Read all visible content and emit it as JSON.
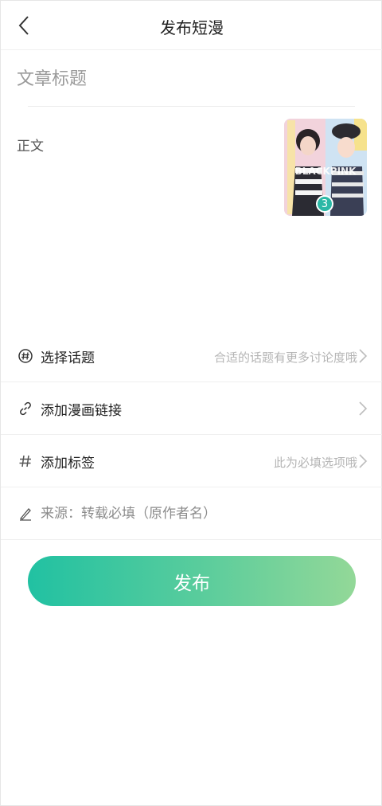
{
  "header": {
    "title": "发布短漫",
    "back_icon": "chevron-left-icon"
  },
  "title_field": {
    "placeholder": "文章标题",
    "value": ""
  },
  "body_field": {
    "placeholder": "正文",
    "value": ""
  },
  "thumbnail": {
    "badge_count": "3",
    "watermark_text": "BLACKPINK"
  },
  "rows": {
    "topic": {
      "label": "选择话题",
      "hint": "合适的话题有更多讨论度哦",
      "icon": "hashtag-bubble-icon"
    },
    "comic_link": {
      "label": "添加漫画链接",
      "icon": "link-icon"
    },
    "tags": {
      "label": "添加标签",
      "hint": "此为必填选项哦",
      "icon": "hash-icon"
    },
    "source": {
      "placeholder": "来源：转载必填（原作者名）",
      "value": "",
      "icon": "pen-icon"
    }
  },
  "publish_button": {
    "label": "发布"
  },
  "colors": {
    "accent_start": "#21c1a2",
    "accent_end": "#93d898",
    "badge": "#2bb8a6"
  }
}
